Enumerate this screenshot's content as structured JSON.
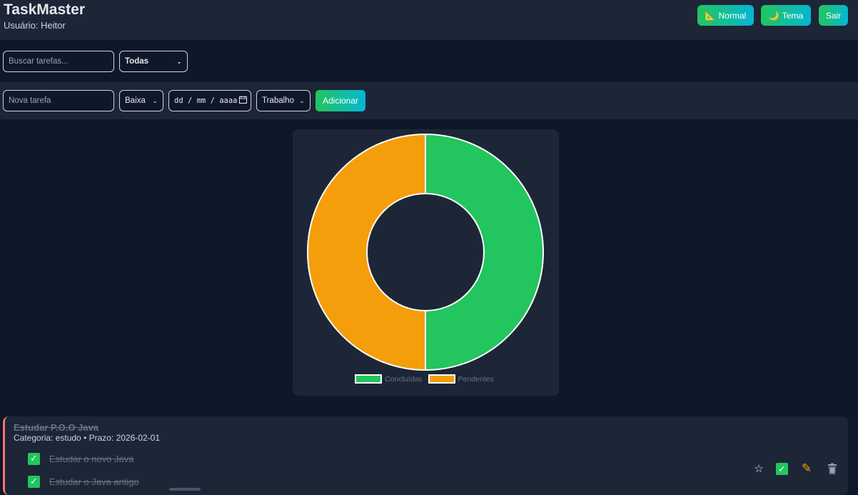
{
  "header": {
    "title": "TaskMaster",
    "user": "Usuário: Heitor",
    "buttons": {
      "normal": {
        "label": "Normal",
        "icon": "📐"
      },
      "tema": {
        "label": "Tema",
        "icon": "🌙"
      },
      "sair": {
        "label": "Sair"
      }
    }
  },
  "filters": {
    "search_placeholder": "Buscar tarefas...",
    "status_selected": "Todas"
  },
  "new_task": {
    "title_placeholder": "Nova tarefa",
    "priority_selected": "Baixa",
    "date_placeholder": "dd / mm / aaaa",
    "category_selected": "Trabalho",
    "add_label": "Adicionar"
  },
  "chart_data": {
    "type": "pie",
    "variant": "doughnut",
    "labels": [
      "Concluídas",
      "Pendentes"
    ],
    "values": [
      1,
      1
    ],
    "colors": [
      "#22c55e",
      "#f59e0b"
    ],
    "legend_position": "bottom"
  },
  "tasks": [
    {
      "title": "Estudar P.O.O Java",
      "meta": "Categoria: estudo • Prazo: 2026-02-01",
      "subtasks": [
        {
          "label": "Estudar o novo Java",
          "done": true
        },
        {
          "label": "Estudar o Java antigo",
          "done": true
        }
      ],
      "actions": {
        "favorite_icon": "star-icon",
        "complete_icon": "check-icon",
        "edit_icon": "pencil-icon",
        "delete_icon": "trash-icon"
      }
    }
  ]
}
